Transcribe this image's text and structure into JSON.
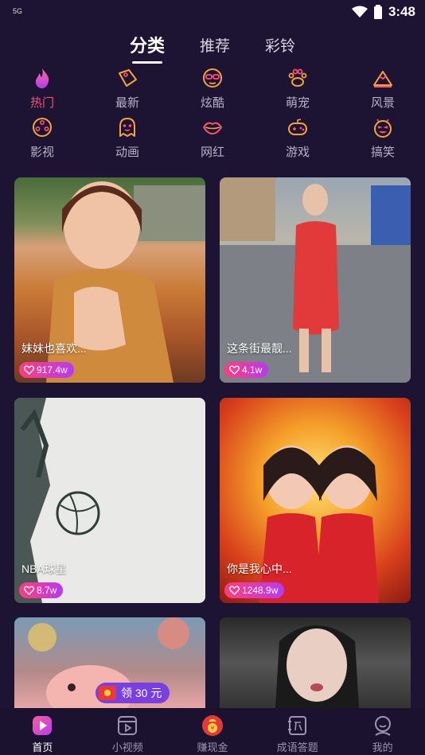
{
  "status": {
    "network": "5G",
    "time": "3:48"
  },
  "top_tabs": [
    {
      "label": "分类"
    },
    {
      "label": "推荐"
    },
    {
      "label": "彩铃"
    }
  ],
  "categories": [
    {
      "label": "热门",
      "icon": "flame-icon"
    },
    {
      "label": "最新",
      "icon": "tag-icon"
    },
    {
      "label": "炫酷",
      "icon": "sunglasses-face-icon"
    },
    {
      "label": "萌宠",
      "icon": "paw-icon"
    },
    {
      "label": "风景",
      "icon": "mountain-icon"
    },
    {
      "label": "影视",
      "icon": "film-reel-icon"
    },
    {
      "label": "动画",
      "icon": "ghost-icon"
    },
    {
      "label": "网红",
      "icon": "lips-icon"
    },
    {
      "label": "游戏",
      "icon": "gamepad-icon"
    },
    {
      "label": "搞笑",
      "icon": "laughing-face-icon"
    }
  ],
  "videos": [
    {
      "title": "妹妹也喜欢...",
      "likes": "917.4w"
    },
    {
      "title": "这条街最靓...",
      "likes": "4.1w"
    },
    {
      "title": "NBA球星",
      "likes": "8.7w"
    },
    {
      "title": "你是我心中...",
      "likes": "1248.9w"
    },
    {
      "title": "",
      "likes": ""
    },
    {
      "title": "",
      "likes": ""
    }
  ],
  "promo": {
    "label": "领 30 元"
  },
  "bottom_nav": [
    {
      "label": "首页",
      "icon": "home-play-icon"
    },
    {
      "label": "小视频",
      "icon": "video-clip-icon"
    },
    {
      "label": "赚现金",
      "icon": "money-bag-icon"
    },
    {
      "label": "成语答题",
      "icon": "idiom-quiz-icon"
    },
    {
      "label": "我的",
      "icon": "profile-icon"
    }
  ],
  "colors": {
    "background": "#1d1433",
    "accent_pink": "#ff4e78",
    "accent_purple": "#b53cf0",
    "icon_orange": "#f7a33a"
  }
}
